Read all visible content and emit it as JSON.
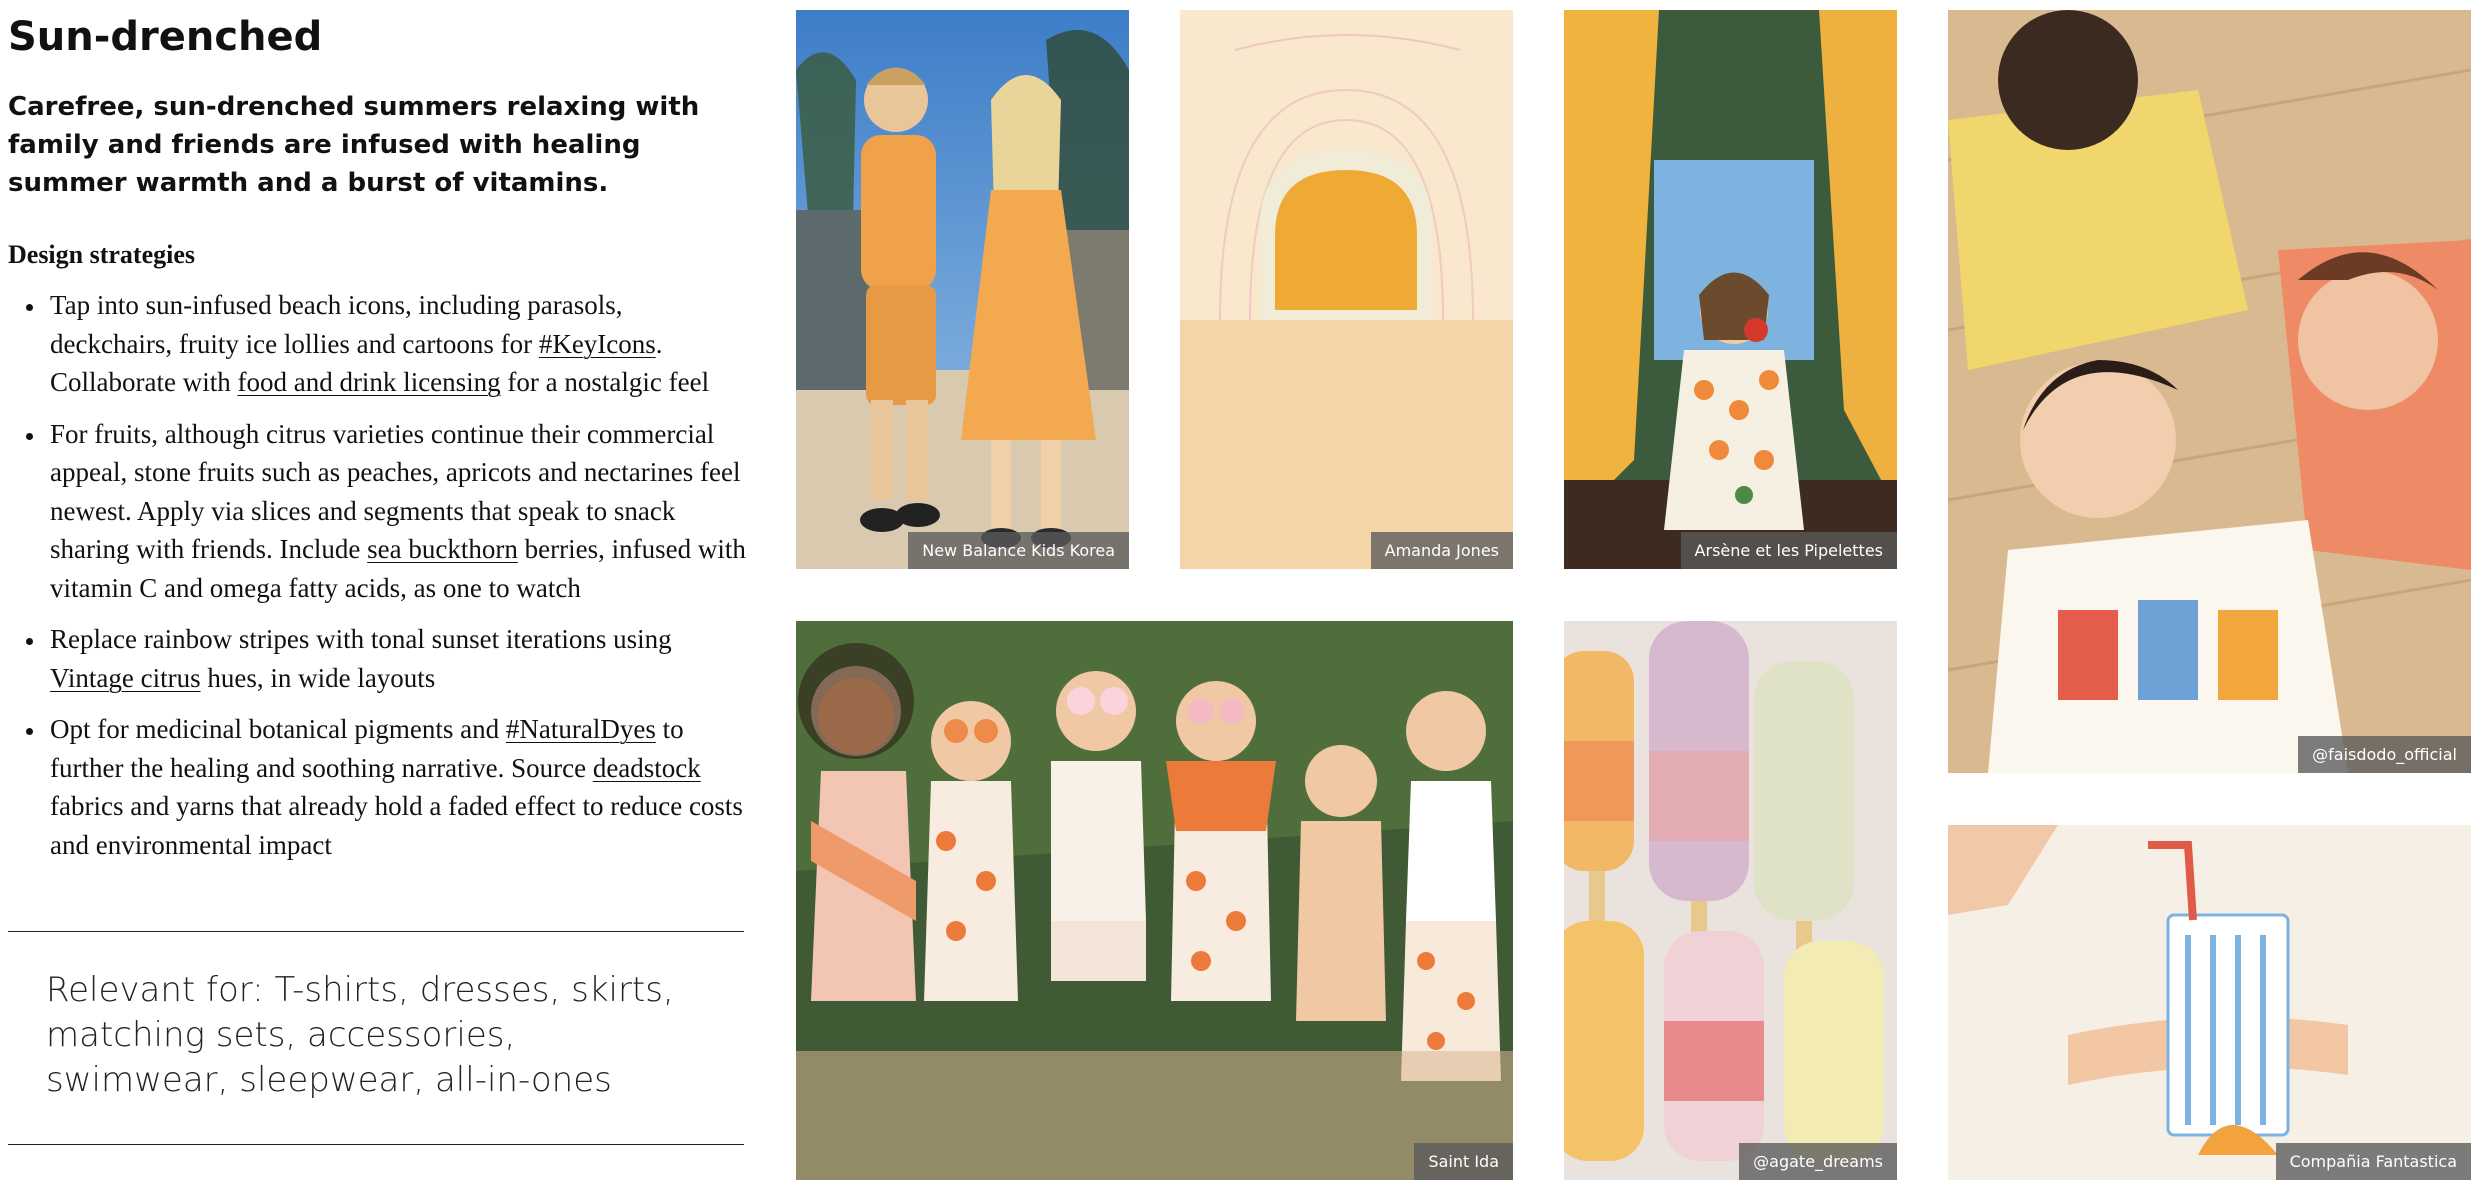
{
  "page": {
    "title": "Sun-drenched",
    "subtitle": "Carefree, sun-drenched summers relaxing with family and friends are infused with healing summer warmth and a burst of vitamins.",
    "strategies_heading": "Design strategies"
  },
  "strategies": [
    {
      "before1": "Tap into sun-infused beach icons, including parasols, deckchairs, fruity ice lollies and cartoons for ",
      "link1": "#KeyIcons",
      "between": ". Collaborate with ",
      "link2": "food and drink licensing",
      "after": " for a nostalgic feel"
    },
    {
      "before1": "For fruits, although citrus varieties continue their commercial appeal, stone fruits such as peaches, apricots and nectarines feel newest. Apply via slices and segments that speak to snack sharing with friends. Include ",
      "link1": "sea buckthorn",
      "between": " berries, infused with vitamin C and omega fatty acids, as one to watch"
    },
    {
      "before1": "Replace rainbow stripes with tonal sunset iterations using ",
      "link1": "Vintage citrus",
      "between": " hues, in wide layouts"
    },
    {
      "before1": "Opt for medicinal botanical pigments and ",
      "link1": "#NaturalDyes",
      "between": " to further the healing and soothing narrative. Source ",
      "link2": "deadstock",
      "after": " fabrics and yarns that already hold a faded effect to reduce costs and environmental impact"
    }
  ],
  "relevant": {
    "text": "Relevant for: T-shirts, dresses, skirts, matching sets, accessories, swimwear, sleepwear, all-in-ones"
  },
  "images": [
    {
      "id": "nb",
      "caption": "New Balance Kids Korea"
    },
    {
      "id": "aj",
      "caption": "Amanda Jones"
    },
    {
      "id": "ap",
      "caption": "Arsène et les Pipelettes"
    },
    {
      "id": "ff",
      "caption": "@faisdodo_official"
    },
    {
      "id": "si",
      "caption": "Saint Ida"
    },
    {
      "id": "ad",
      "caption": "@agate_dreams"
    },
    {
      "id": "cf",
      "caption": "Compañia Fantastica"
    }
  ],
  "colors": {
    "orange": "#e8a040",
    "peach": "#f4d3a4",
    "caption_bg": "#5a5a5a"
  }
}
